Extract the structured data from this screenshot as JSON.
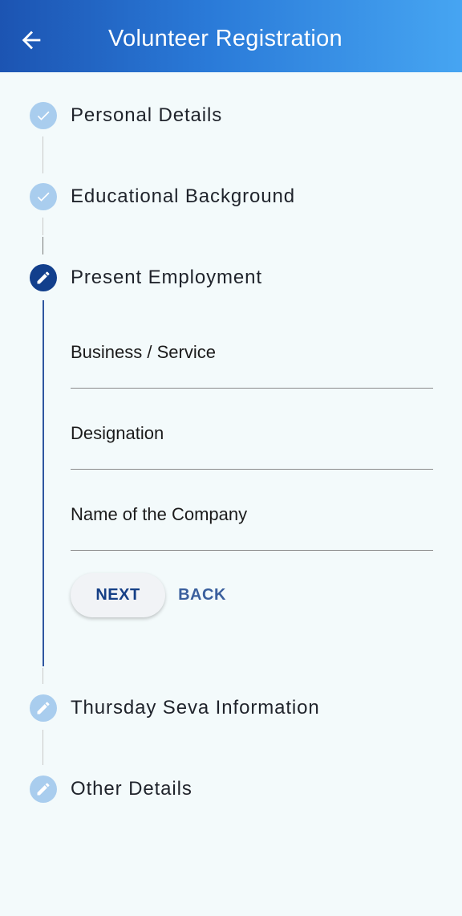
{
  "appbar": {
    "title": "Volunteer Registration",
    "back_icon": "arrow-left-icon"
  },
  "steps": [
    {
      "label": "Personal Details",
      "state": "completed",
      "icon": "check-icon"
    },
    {
      "label": "Educational Background",
      "state": "completed",
      "icon": "check-icon"
    },
    {
      "label": "Present Employment",
      "state": "active",
      "icon": "edit-pencil-icon"
    },
    {
      "label": "Thursday Seva Information",
      "state": "pending",
      "icon": "edit-pencil-icon"
    },
    {
      "label": "Other Details",
      "state": "pending",
      "icon": "edit-pencil-icon"
    }
  ],
  "form": {
    "fields": [
      {
        "label": "Business / Service",
        "value": ""
      },
      {
        "label": "Designation",
        "value": ""
      },
      {
        "label": "Name of the Company",
        "value": ""
      }
    ],
    "next_label": "NEXT",
    "back_label": "BACK"
  },
  "colors": {
    "appbar_gradient_start": "#1c54b2",
    "appbar_gradient_end": "#46a5f2",
    "active_step": "#123f8c",
    "inactive_step": "#a9cdee",
    "background": "#f3fafb",
    "button_text": "#153f86"
  }
}
